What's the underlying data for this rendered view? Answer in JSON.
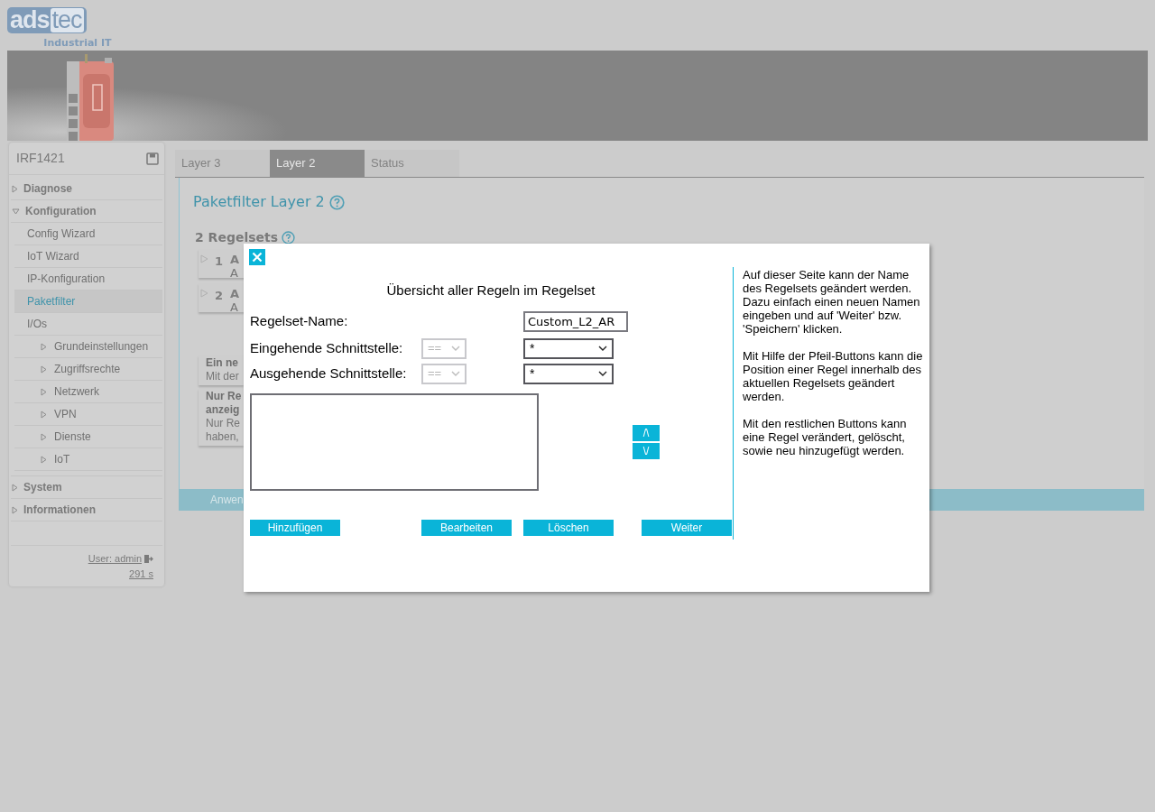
{
  "logo": {
    "brand_left": "ads",
    "brand_right": "tec",
    "tagline": "Industrial IT"
  },
  "sidebar": {
    "device": "IRF1421",
    "items": [
      {
        "label": "Diagnose",
        "expanded": false
      },
      {
        "label": "Konfiguration",
        "expanded": true,
        "children": [
          {
            "kind": "page",
            "label": "Config Wizard",
            "selected": false
          },
          {
            "kind": "page",
            "label": "IoT Wizard",
            "selected": false
          },
          {
            "kind": "page",
            "label": "IP-Konfiguration",
            "selected": false
          },
          {
            "kind": "page",
            "label": "Paketfilter",
            "selected": true
          },
          {
            "kind": "page",
            "label": "I/Os",
            "selected": false
          },
          {
            "kind": "group",
            "label": "Grundeinstellungen",
            "selected": false
          },
          {
            "kind": "group",
            "label": "Zugriffsrechte",
            "selected": false
          },
          {
            "kind": "group",
            "label": "Netzwerk",
            "selected": false
          },
          {
            "kind": "group",
            "label": "VPN",
            "selected": false
          },
          {
            "kind": "group",
            "label": "Dienste",
            "selected": false
          },
          {
            "kind": "group",
            "label": "IoT",
            "selected": false
          }
        ]
      },
      {
        "label": "System",
        "expanded": false
      },
      {
        "label": "Informationen",
        "expanded": false
      }
    ],
    "user": "User: admin",
    "timer": "291 s"
  },
  "tabs": [
    {
      "label": "Layer 3",
      "selected": false
    },
    {
      "label": "Layer 2",
      "selected": true
    },
    {
      "label": "Status",
      "selected": false
    }
  ],
  "content": {
    "title": "Paketfilter Layer 2",
    "regelsets_heading": "2 Regelsets",
    "rulesets": [
      {
        "number": "1",
        "name": "A",
        "subtitle": "A"
      },
      {
        "number": "2",
        "name": "A",
        "subtitle": "A"
      }
    ],
    "info_cards": [
      {
        "title_lines": [
          "Ein ne"
        ],
        "text_lines": [
          "Mit der"
        ]
      },
      {
        "title_lines": [
          "Nur Re",
          "anzeig"
        ],
        "text_lines": [
          "Nur Re",
          "haben,"
        ]
      }
    ],
    "apply_button": "Anwen"
  },
  "dialog": {
    "title": "Übersicht aller Regeln im Regelset",
    "name_field": {
      "label": "Regelset-Name:",
      "value": "Custom_L2_AR"
    },
    "filters": [
      {
        "label": "Eingehende Schnittstelle:",
        "operator": "==",
        "operator_disabled": true,
        "value": "*"
      },
      {
        "label": "Ausgehende Schnittstelle:",
        "operator": "==",
        "operator_disabled": true,
        "value": "*"
      }
    ],
    "move_buttons": [
      "/\\",
      "\\/"
    ],
    "buttons": [
      "Hinzufügen",
      "Bearbeiten",
      "Löschen",
      "Weiter"
    ],
    "help": [
      "Auf dieser Seite kann der Name des Regelsets geändert werden. Dazu einfach einen neuen Namen eingeben und auf 'Weiter' bzw. 'Speichern' klicken.",
      "Mit Hilfe der Pfeil-Buttons kann die Position einer Regel innerhalb des aktuellen Regelsets geändert werden.",
      "Mit den restlichen Buttons kann eine Regel verändert, gelöscht, sowie neu hinzugefügt werden."
    ]
  }
}
